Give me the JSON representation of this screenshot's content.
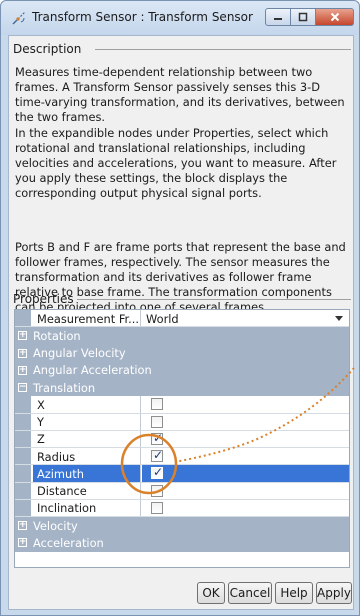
{
  "window": {
    "title": "Transform Sensor : Transform  Sensor",
    "icon": "transform-sensor-icon",
    "controls": {
      "minimize": "minimize-icon",
      "maximize": "maximize-icon",
      "close": "close-icon"
    }
  },
  "description": {
    "legend": "Description",
    "paragraphs": [
      "Measures time-dependent relationship between two frames. A Transform Sensor passively senses this 3-D time-varying transformation, and its derivatives, between the two frames.",
      "In the expandible nodes under Properties, select which rotational and translational relationships, including velocities and accelerations, you want to measure. After you apply these settings, the block displays the corresponding output physical signal ports.",
      "Ports B and F are frame ports that represent the base and follower frames, respectively. The sensor measures the transformation and its derivatives as follower frame relative to base frame. The transformation components can be projected into one of several frames."
    ]
  },
  "properties": {
    "legend": "Properties",
    "measurement_frame": {
      "label": "Measurement Fr...",
      "value": "World"
    },
    "categories": {
      "rotation": "Rotation",
      "angular_velocity": "Angular Velocity",
      "angular_acceleration": "Angular Acceleration",
      "translation": "Translation",
      "velocity": "Velocity",
      "acceleration": "Acceleration"
    },
    "translation_items": [
      {
        "label": "X",
        "checked": false
      },
      {
        "label": "Y",
        "checked": false
      },
      {
        "label": "Z",
        "checked": true
      },
      {
        "label": "Radius",
        "checked": true
      },
      {
        "label": "Azimuth",
        "checked": true,
        "selected": true
      },
      {
        "label": "Distance",
        "checked": false
      },
      {
        "label": "Inclination",
        "checked": false
      }
    ],
    "expander_collapsed": "+",
    "expander_expanded": "−"
  },
  "buttons": {
    "ok": "OK",
    "cancel": "Cancel",
    "help": "Help",
    "apply": "Apply"
  },
  "colors": {
    "category_bg": "#a4b3c6",
    "selection": "#3875d7",
    "annotation": "#d9822b"
  }
}
